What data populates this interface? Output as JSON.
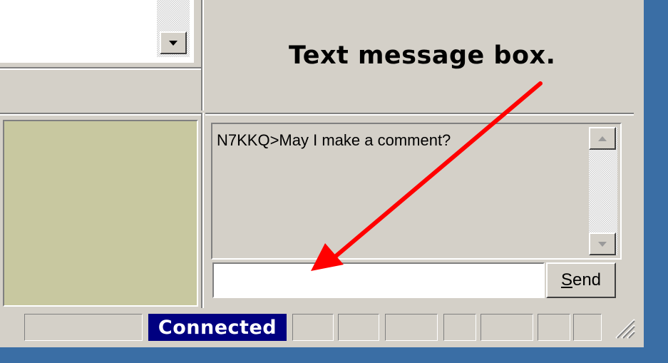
{
  "annotation": {
    "text": "Text message box."
  },
  "messages": {
    "lines": [
      "N7KKQ>May I make a comment?"
    ]
  },
  "input": {
    "value": "",
    "placeholder": ""
  },
  "send_button": {
    "label_accel": "S",
    "label_rest": "end"
  },
  "status_bar": {
    "connection": "Connected"
  },
  "colors": {
    "window": "#d4d0c8",
    "desktop": "#3a6ea5",
    "olive_panel": "#c8c8a0",
    "status_highlight": "#000080",
    "arrow": "#ff0000"
  },
  "icons": [
    "scroll-down-arrow-icon",
    "scroll-up-arrow-icon",
    "resize-grip-icon"
  ]
}
